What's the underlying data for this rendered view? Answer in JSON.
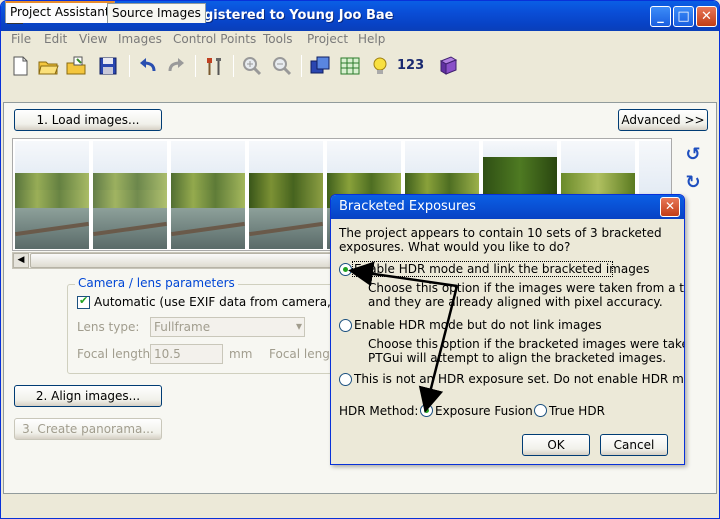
{
  "window": {
    "title": "Untitled * - PTGui Pro registered to Young Joo Bae",
    "minimize": "_",
    "maximize": "□",
    "close": "✕"
  },
  "menu": [
    "File",
    "Edit",
    "View",
    "Images",
    "Control Points",
    "Tools",
    "Project",
    "Help"
  ],
  "toolbar": {
    "number_label": "123",
    "icons": [
      "new-icon",
      "open-icon",
      "open-template-icon",
      "save-icon",
      "undo-icon",
      "redo-icon",
      "tools-icon",
      "zoom-in-icon",
      "zoom-out-icon",
      "panorama-editor-icon",
      "table-icon",
      "bulb-icon",
      "numbering-icon",
      "book-icon"
    ]
  },
  "tabs": [
    "Project Assistant",
    "Source Images"
  ],
  "assistant": {
    "load_images": "1. Load images...",
    "advanced": "Advanced >>",
    "align_images": "2. Align images...",
    "create_panorama": "3. Create panorama...",
    "camera_group_title": "Camera / lens parameters",
    "automatic_label": "Automatic (use EXIF data from camera, if ava",
    "automatic_checked": true,
    "lens_type_label": "Lens type:",
    "lens_type_value": "Fullframe",
    "focal_length_label": "Focal length:",
    "focal_length_value": "10.5",
    "focal_length_unit": "mm",
    "focal_length_mult_label": "Focal length"
  },
  "dialog": {
    "title": "Bracketed Exposures",
    "intro": [
      "The project appears to contain 10 sets of 3 bracketed",
      "exposures. What would you like to do?"
    ],
    "option1": "Enable HDR mode and link the bracketed images",
    "option1_desc": [
      "Choose this option if the images were taken from a tripod,",
      "and they are already aligned with pixel accuracy."
    ],
    "option2": "Enable HDR mode but do not link images",
    "option2_desc": [
      "Choose this option if the bracketed images were taken handheld.",
      "PTGui will attempt to align the bracketed images."
    ],
    "option3": "This is not an HDR exposure set. Do not enable HDR mode.",
    "selected_option": 1,
    "hdr_method_label": "HDR Method:",
    "method_fusion": "Exposure Fusion",
    "method_truehdr": "True HDR",
    "selected_method": "Exposure Fusion",
    "ok": "OK",
    "cancel": "Cancel"
  },
  "colors": {
    "title_bar": "#0842c4",
    "accent_green": "#21a121",
    "link_blue": "#0046d5"
  }
}
